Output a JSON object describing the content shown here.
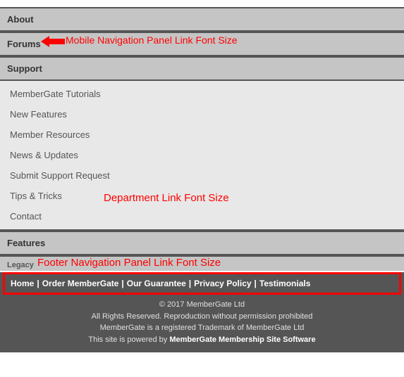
{
  "nav": {
    "about": "About",
    "forums": "Forums",
    "support": "Support",
    "features": "Features",
    "legacy": "Legacy"
  },
  "dept_links": [
    "MemberGate Tutorials",
    "New Features",
    "Member Resources",
    "News & Updates",
    "Submit Support Request",
    "Tips & Tricks",
    "Contact"
  ],
  "footer_links": [
    "Home",
    "Order MemberGate",
    "Our Guarantee",
    "Privacy Policy",
    "Testimonials"
  ],
  "footer_text": {
    "copyright": "© 2017 MemberGate Ltd",
    "rights": "All Rights Reserved. Reproduction without permission prohibited",
    "trademark": "MemberGate is a registered Trademark of MemberGate Ltd",
    "powered_prefix": "This site is powered by ",
    "powered_link": "MemberGate Membership Site Software"
  },
  "annotations": {
    "mobile_nav": "Mobile Navigation Panel Link Font Size",
    "dept_link": "Department Link Font Size",
    "footer_nav": "Footer Navigation Panel Link Font Size"
  }
}
